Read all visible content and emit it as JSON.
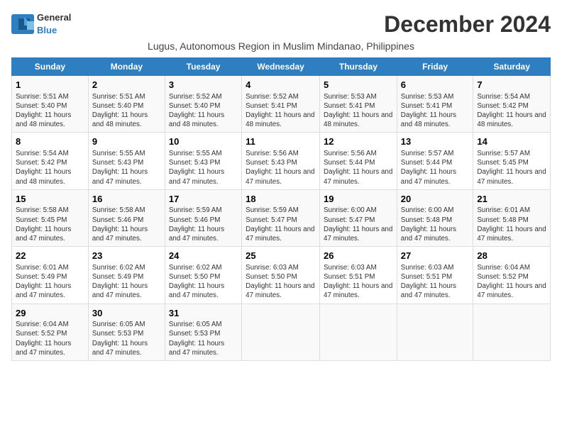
{
  "logo": {
    "general": "General",
    "blue": "Blue"
  },
  "title": "December 2024",
  "subtitle": "Lugus, Autonomous Region in Muslim Mindanao, Philippines",
  "headers": [
    "Sunday",
    "Monday",
    "Tuesday",
    "Wednesday",
    "Thursday",
    "Friday",
    "Saturday"
  ],
  "weeks": [
    [
      {
        "day": "1",
        "info": "Sunrise: 5:51 AM\nSunset: 5:40 PM\nDaylight: 11 hours and 48 minutes."
      },
      {
        "day": "2",
        "info": "Sunrise: 5:51 AM\nSunset: 5:40 PM\nDaylight: 11 hours and 48 minutes."
      },
      {
        "day": "3",
        "info": "Sunrise: 5:52 AM\nSunset: 5:40 PM\nDaylight: 11 hours and 48 minutes."
      },
      {
        "day": "4",
        "info": "Sunrise: 5:52 AM\nSunset: 5:41 PM\nDaylight: 11 hours and 48 minutes."
      },
      {
        "day": "5",
        "info": "Sunrise: 5:53 AM\nSunset: 5:41 PM\nDaylight: 11 hours and 48 minutes."
      },
      {
        "day": "6",
        "info": "Sunrise: 5:53 AM\nSunset: 5:41 PM\nDaylight: 11 hours and 48 minutes."
      },
      {
        "day": "7",
        "info": "Sunrise: 5:54 AM\nSunset: 5:42 PM\nDaylight: 11 hours and 48 minutes."
      }
    ],
    [
      {
        "day": "8",
        "info": "Sunrise: 5:54 AM\nSunset: 5:42 PM\nDaylight: 11 hours and 48 minutes."
      },
      {
        "day": "9",
        "info": "Sunrise: 5:55 AM\nSunset: 5:43 PM\nDaylight: 11 hours and 47 minutes."
      },
      {
        "day": "10",
        "info": "Sunrise: 5:55 AM\nSunset: 5:43 PM\nDaylight: 11 hours and 47 minutes."
      },
      {
        "day": "11",
        "info": "Sunrise: 5:56 AM\nSunset: 5:43 PM\nDaylight: 11 hours and 47 minutes."
      },
      {
        "day": "12",
        "info": "Sunrise: 5:56 AM\nSunset: 5:44 PM\nDaylight: 11 hours and 47 minutes."
      },
      {
        "day": "13",
        "info": "Sunrise: 5:57 AM\nSunset: 5:44 PM\nDaylight: 11 hours and 47 minutes."
      },
      {
        "day": "14",
        "info": "Sunrise: 5:57 AM\nSunset: 5:45 PM\nDaylight: 11 hours and 47 minutes."
      }
    ],
    [
      {
        "day": "15",
        "info": "Sunrise: 5:58 AM\nSunset: 5:45 PM\nDaylight: 11 hours and 47 minutes."
      },
      {
        "day": "16",
        "info": "Sunrise: 5:58 AM\nSunset: 5:46 PM\nDaylight: 11 hours and 47 minutes."
      },
      {
        "day": "17",
        "info": "Sunrise: 5:59 AM\nSunset: 5:46 PM\nDaylight: 11 hours and 47 minutes."
      },
      {
        "day": "18",
        "info": "Sunrise: 5:59 AM\nSunset: 5:47 PM\nDaylight: 11 hours and 47 minutes."
      },
      {
        "day": "19",
        "info": "Sunrise: 6:00 AM\nSunset: 5:47 PM\nDaylight: 11 hours and 47 minutes."
      },
      {
        "day": "20",
        "info": "Sunrise: 6:00 AM\nSunset: 5:48 PM\nDaylight: 11 hours and 47 minutes."
      },
      {
        "day": "21",
        "info": "Sunrise: 6:01 AM\nSunset: 5:48 PM\nDaylight: 11 hours and 47 minutes."
      }
    ],
    [
      {
        "day": "22",
        "info": "Sunrise: 6:01 AM\nSunset: 5:49 PM\nDaylight: 11 hours and 47 minutes."
      },
      {
        "day": "23",
        "info": "Sunrise: 6:02 AM\nSunset: 5:49 PM\nDaylight: 11 hours and 47 minutes."
      },
      {
        "day": "24",
        "info": "Sunrise: 6:02 AM\nSunset: 5:50 PM\nDaylight: 11 hours and 47 minutes."
      },
      {
        "day": "25",
        "info": "Sunrise: 6:03 AM\nSunset: 5:50 PM\nDaylight: 11 hours and 47 minutes."
      },
      {
        "day": "26",
        "info": "Sunrise: 6:03 AM\nSunset: 5:51 PM\nDaylight: 11 hours and 47 minutes."
      },
      {
        "day": "27",
        "info": "Sunrise: 6:03 AM\nSunset: 5:51 PM\nDaylight: 11 hours and 47 minutes."
      },
      {
        "day": "28",
        "info": "Sunrise: 6:04 AM\nSunset: 5:52 PM\nDaylight: 11 hours and 47 minutes."
      }
    ],
    [
      {
        "day": "29",
        "info": "Sunrise: 6:04 AM\nSunset: 5:52 PM\nDaylight: 11 hours and 47 minutes."
      },
      {
        "day": "30",
        "info": "Sunrise: 6:05 AM\nSunset: 5:53 PM\nDaylight: 11 hours and 47 minutes."
      },
      {
        "day": "31",
        "info": "Sunrise: 6:05 AM\nSunset: 5:53 PM\nDaylight: 11 hours and 47 minutes."
      },
      null,
      null,
      null,
      null
    ]
  ]
}
